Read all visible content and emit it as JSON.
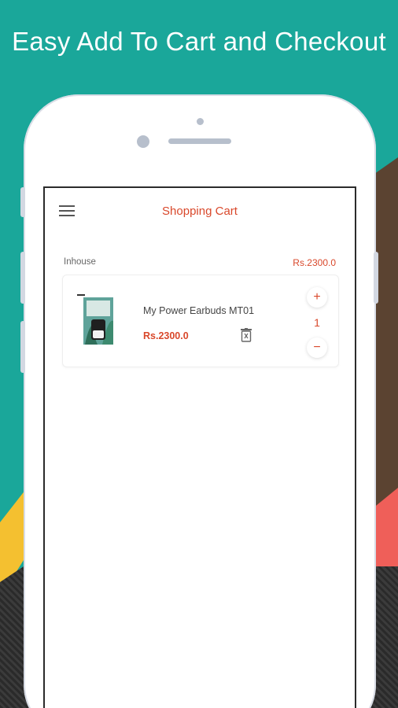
{
  "headline": "Easy Add To Cart and Checkout",
  "appbar": {
    "title": "Shopping Cart",
    "menu_icon": "hamburger-icon"
  },
  "cart": {
    "seller": "Inhouse",
    "seller_total": "Rs.2300.0",
    "items": [
      {
        "name": "My Power Earbuds MT01",
        "price": "Rs.2300.0",
        "quantity": "1",
        "plus_label": "+",
        "minus_label": "−"
      }
    ]
  },
  "colors": {
    "accent": "#d9482b",
    "background": "#1aa79a"
  }
}
